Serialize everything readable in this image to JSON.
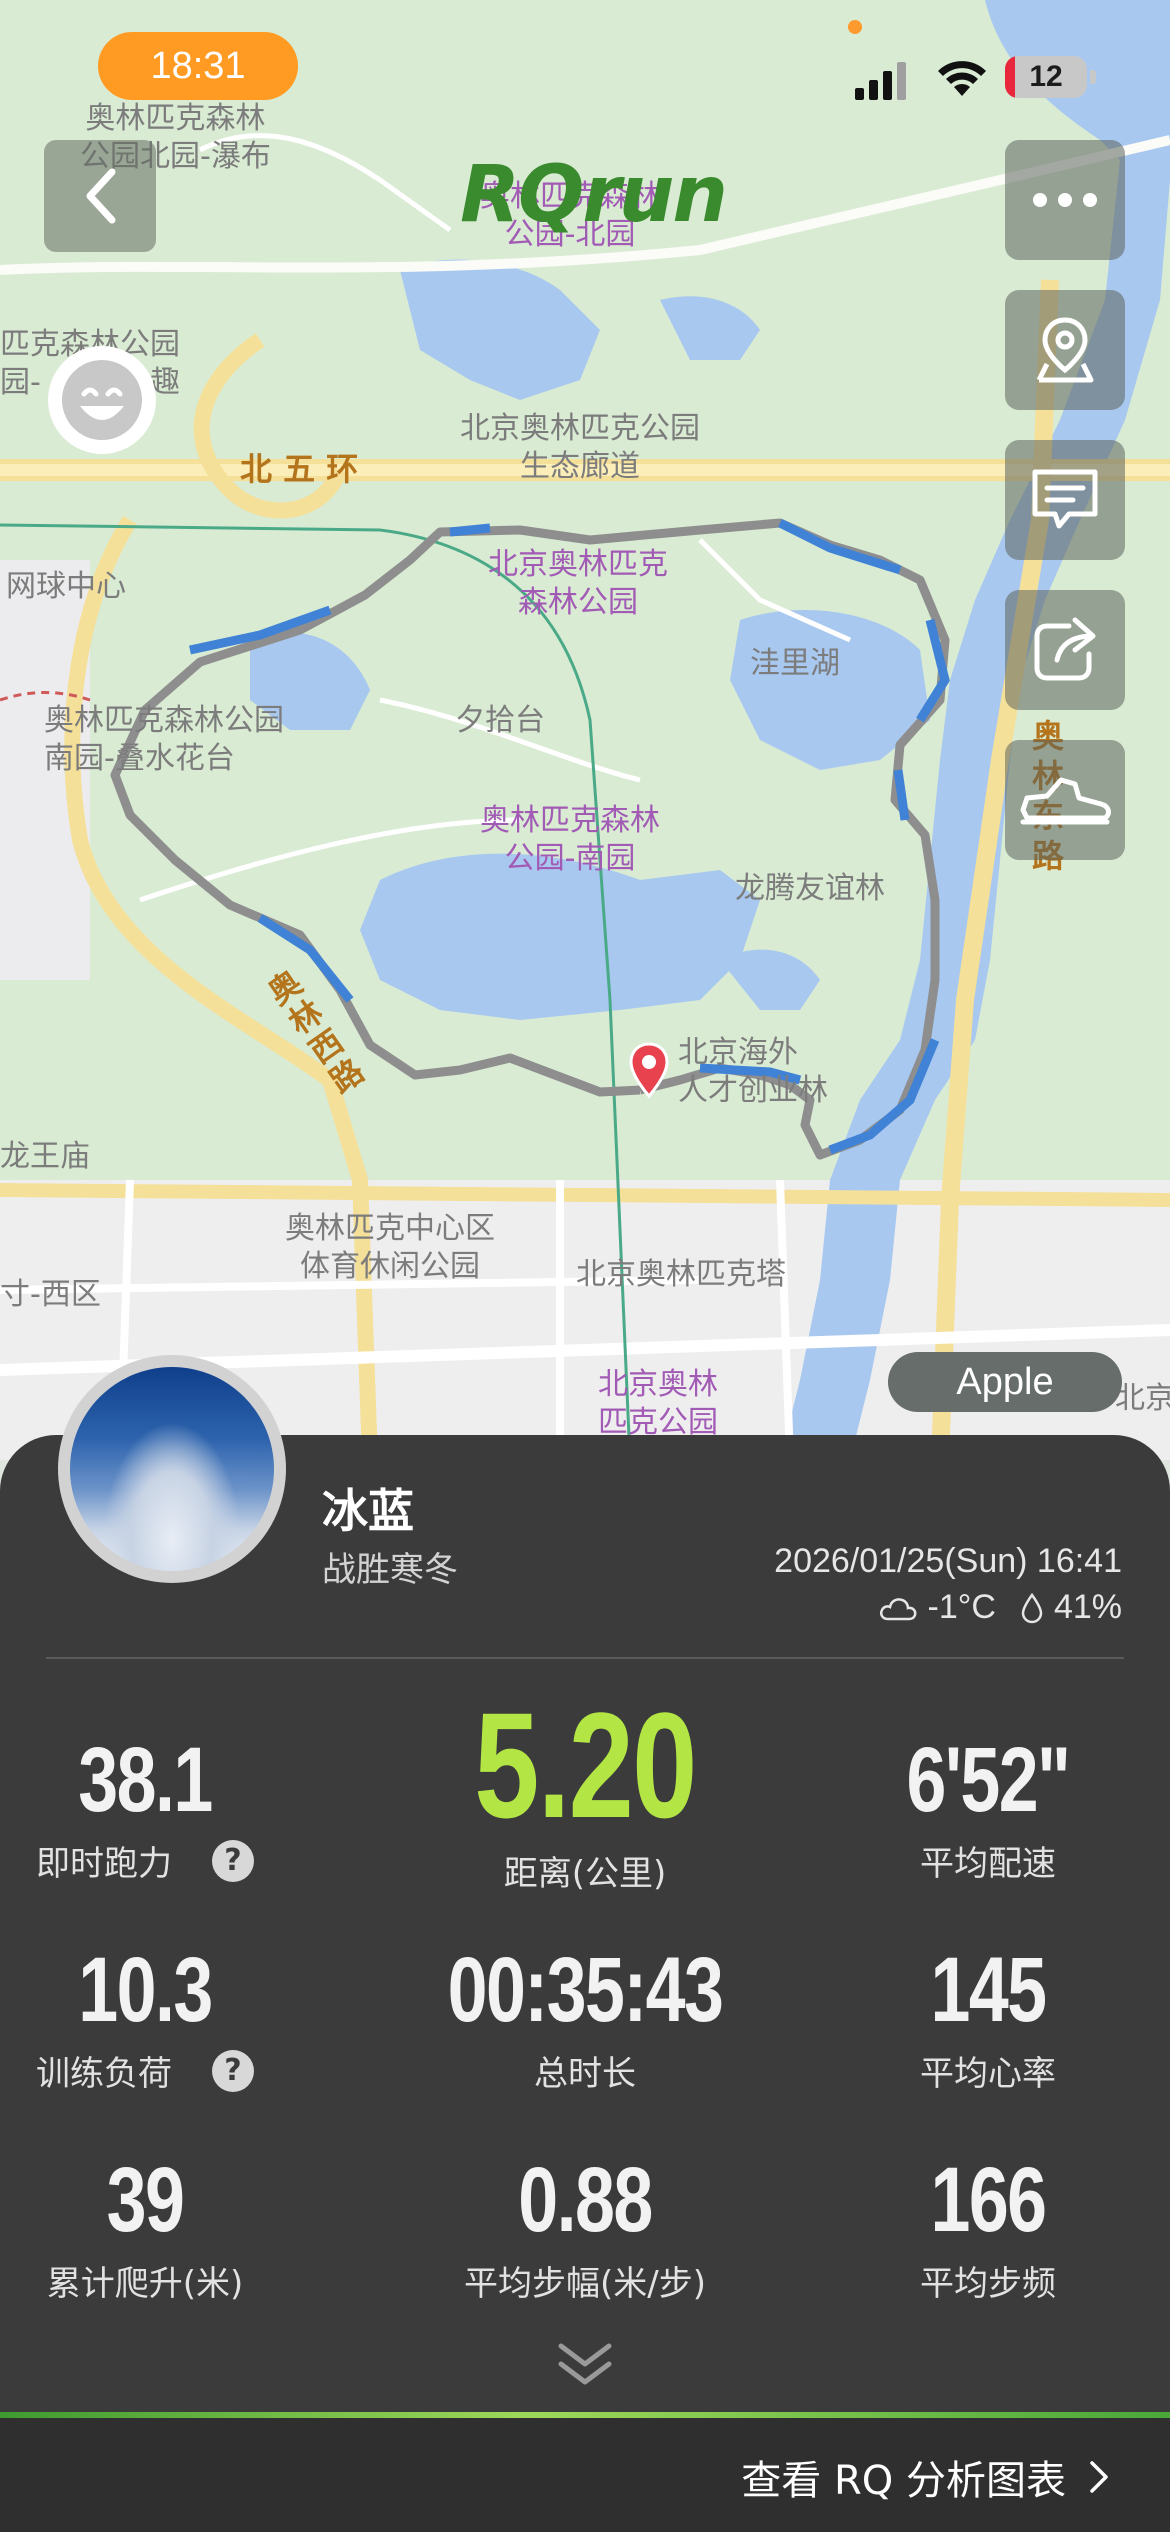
{
  "status_bar": {
    "time": "18:31",
    "battery": "12",
    "battery_level": 0.12
  },
  "app": {
    "logo": "RQrun"
  },
  "map": {
    "labels": [
      {
        "id": "l1",
        "text": "奥林匹克森林\n公园北园-瀑布",
        "style": "gray"
      },
      {
        "id": "l2",
        "text": "奥林匹克森林\n公园-北园",
        "style": "purple"
      },
      {
        "id": "l3",
        "text": "匹克森林公园\n园-",
        "style": "gray"
      },
      {
        "id": "l3b",
        "text": "趣",
        "style": "gray"
      },
      {
        "id": "l4",
        "text": "北京奥林匹克公园\n生态廊道",
        "style": "gray"
      },
      {
        "id": "l5",
        "text": "北 五 环",
        "style": "road"
      },
      {
        "id": "l6",
        "text": "网球中心",
        "style": "gray"
      },
      {
        "id": "l7",
        "text": "北京奥林匹克\n森林公园",
        "style": "purple"
      },
      {
        "id": "l8",
        "text": "洼里湖",
        "style": "gray"
      },
      {
        "id": "l9",
        "text": "奥林匹克森林公园\n南园-叠水花台",
        "style": "gray"
      },
      {
        "id": "l10",
        "text": "夕拾台",
        "style": "gray"
      },
      {
        "id": "l11",
        "text": "奥林匹克森林\n公园-南园",
        "style": "purple"
      },
      {
        "id": "l12",
        "text": "龙腾友谊林",
        "style": "gray"
      },
      {
        "id": "l13",
        "text": "北京海外\n人才创业林",
        "style": "gray"
      },
      {
        "id": "l14",
        "text": "龙王庙",
        "style": "gray"
      },
      {
        "id": "l15",
        "text": "奥林匹克中心区\n体育休闲公园",
        "style": "gray"
      },
      {
        "id": "l16",
        "text": "北京奥林匹克塔",
        "style": "gray"
      },
      {
        "id": "l17",
        "text": "寸-西区",
        "style": "gray"
      },
      {
        "id": "l18",
        "text": "北京奥林\n匹克公园",
        "style": "purple"
      },
      {
        "id": "l19",
        "text": "北京",
        "style": "gray"
      },
      {
        "id": "l20",
        "text": "奥\n林\n东\n路",
        "style": "road"
      },
      {
        "id": "l21",
        "text": "奥\n林\n西\n路",
        "style": "road"
      }
    ],
    "attribution": "Apple"
  },
  "profile": {
    "name": "冰蓝",
    "subtitle": "战胜寒冬",
    "datetime": "2026/01/25(Sun) 16:41",
    "temperature": "-1°C",
    "humidity": "41%"
  },
  "stats": {
    "instant_power": {
      "value": "38.1",
      "label": "即时跑力"
    },
    "distance": {
      "value": "5.20",
      "label": "距离(公里)"
    },
    "avg_pace": {
      "value": "6'52\"",
      "label": "平均配速"
    },
    "training_load": {
      "value": "10.3",
      "label": "训练负荷"
    },
    "total_time": {
      "value": "00:35:43",
      "label": "总时长"
    },
    "avg_hr": {
      "value": "145",
      "label": "平均心率"
    },
    "elevation": {
      "value": "39",
      "label": "累计爬升(米)"
    },
    "avg_stride": {
      "value": "0.88",
      "label": "平均步幅(米/步)"
    },
    "avg_cadence": {
      "value": "166",
      "label": "平均步频"
    },
    "help_symbol": "?"
  },
  "footer": {
    "link": "查看 RQ 分析图表"
  },
  "colors": {
    "accent": "#b3e545",
    "panel": "#3b3b3b",
    "route_gray": "#8e8e8e",
    "route_blue": "#3f82d6"
  }
}
